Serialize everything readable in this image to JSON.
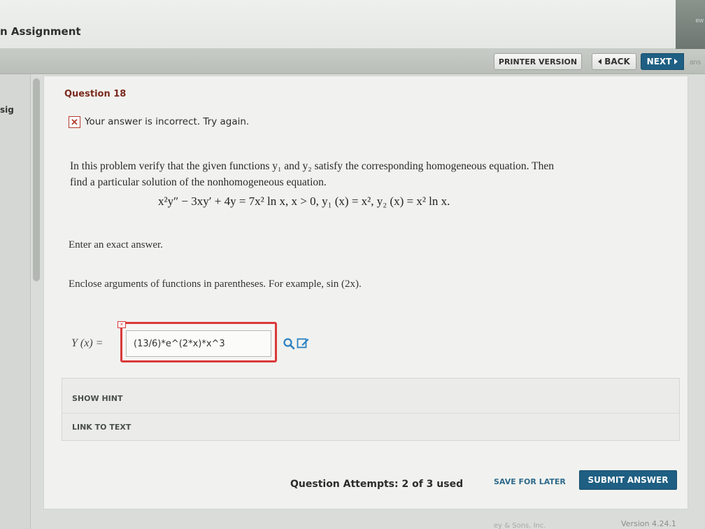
{
  "header": {
    "title": "n Assignment",
    "corner_label": "ew"
  },
  "nav": {
    "printer_label": "PRINTER VERSION",
    "back_label": "BACK",
    "next_label": "NEXT",
    "right_label": "ans"
  },
  "sidebar": {
    "label": "sig"
  },
  "question": {
    "title": "Question 18",
    "status_message": "Your answer is incorrect.  Try again.",
    "problem_line_1": "In this problem verify that the given functions y₁ and y₂ satisfy the corresponding homogeneous equation. Then",
    "problem_line_2": "find a particular solution of the nonhomogeneous equation.",
    "equation": "x²y″ − 3xy′ + 4y = 7x² ln x, x > 0, y₁ (x) = x², y₂ (x) = x² ln x.",
    "instruction_exact": "Enter an exact answer.",
    "instruction_enclose": "Enclose arguments of functions in parentheses. For example, sin (2x)."
  },
  "answer": {
    "label": "Y (x) =",
    "value": "(13/6)*e^(2*x)*x^3"
  },
  "hints": {
    "show_hint_label": "SHOW HINT",
    "link_to_text_label": "LINK TO TEXT"
  },
  "footer": {
    "attempts_text": "Question Attempts: 2 of 3 used",
    "save_label": "SAVE FOR LATER",
    "submit_label": "SUBMIT ANSWER",
    "version_text": "Version 4.24.1",
    "copyright_fragment": "ey & Sons, Inc."
  },
  "colors": {
    "accent": "#1e5f83",
    "error": "#d93a3a",
    "question_title": "#7a2a1e"
  },
  "icons": {
    "incorrect": "close-icon",
    "search": "search-icon",
    "edit": "edit-icon",
    "back": "chevron-left-icon",
    "next": "chevron-right-icon"
  }
}
